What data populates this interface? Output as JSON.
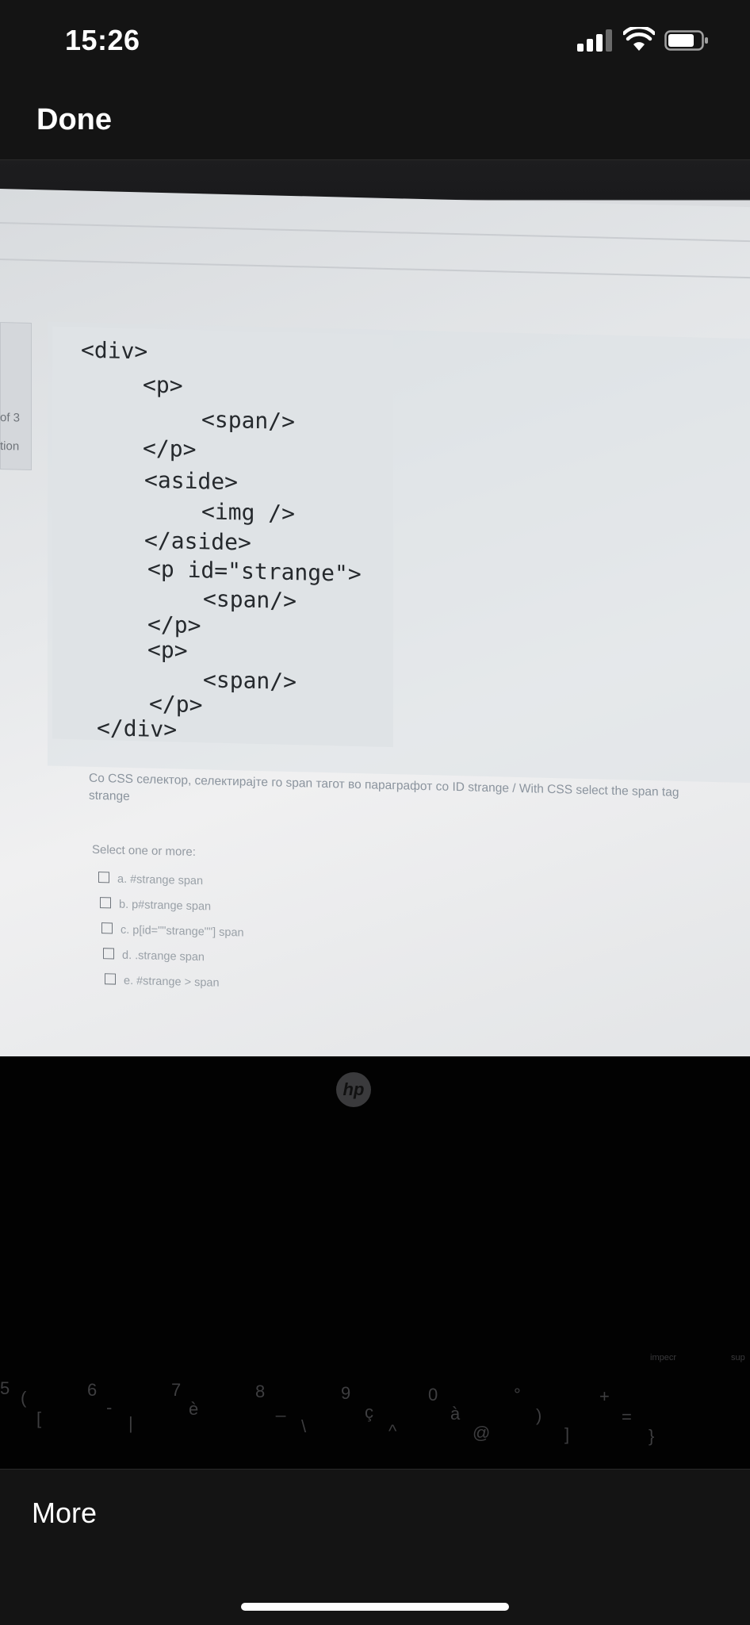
{
  "status_bar": {
    "time": "15:26"
  },
  "nav": {
    "done_label": "Done"
  },
  "bottom": {
    "more_label": "More"
  },
  "photo": {
    "left_panel": {
      "line1": "of 3",
      "line2": "tion"
    },
    "code_lines": [
      "<div>",
      "<p>",
      "<span/>",
      "</p>",
      "<aside>",
      "<img />",
      "</aside>",
      "<p id=\"strange\">",
      "<span/>",
      "</p>",
      "<p>",
      "<span/>",
      "</p>",
      "</div>"
    ],
    "question_text": "Со CSS селектор, селектирајте го span тагот во параграфот со ID strange / With CSS select the span tag",
    "question_text_2": "strange",
    "select_label": "Select one or more:",
    "options": [
      "a. #strange span",
      "b. p#strange span",
      "c. p[id=\"\"strange\"\"] span",
      "d. .strange span",
      "e. #strange > span"
    ],
    "laptop_brand": "hp",
    "keys": [
      "5",
      "(",
      "[",
      "6",
      "-",
      "|",
      "7",
      "è",
      "8",
      "_",
      "\\",
      "9",
      "ç",
      "^",
      "0",
      "à",
      "@",
      "°",
      ")",
      "]",
      "+",
      "=",
      "}"
    ],
    "fn_keys": [
      "impecr",
      "sup"
    ]
  }
}
